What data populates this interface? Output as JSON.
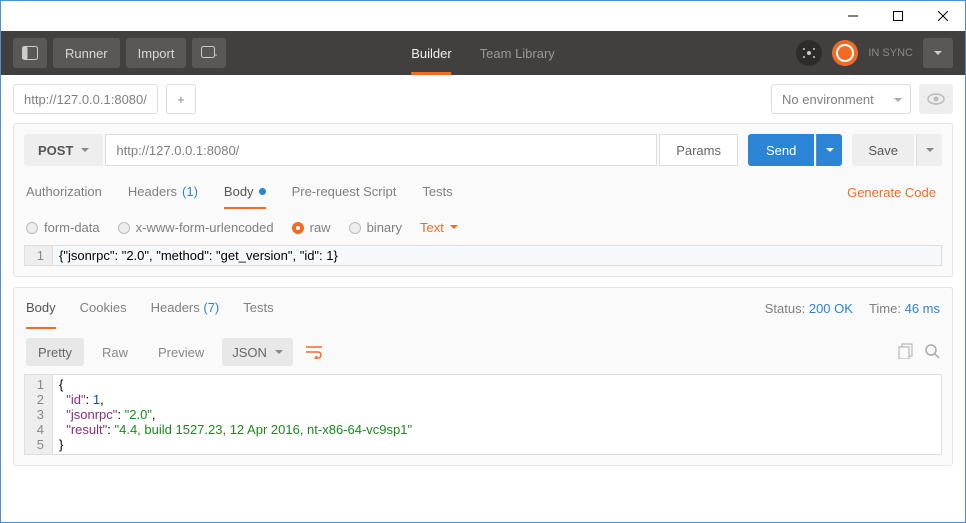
{
  "titlebar": {
    "min": "–",
    "max": "☐",
    "close": "✕"
  },
  "toolbar": {
    "runner": "Runner",
    "import": "Import",
    "tabs": {
      "builder": "Builder",
      "team": "Team Library"
    },
    "sync": "IN SYNC"
  },
  "subbar": {
    "tab_addr": "http://127.0.0.1:8080/",
    "env": "No environment"
  },
  "request": {
    "method": "POST",
    "url": "http://127.0.0.1:8080/",
    "params": "Params",
    "send": "Send",
    "save": "Save",
    "tabs": {
      "auth": "Authorization",
      "headers": "Headers",
      "headers_count": "(1)",
      "body": "Body",
      "prereq": "Pre-request Script",
      "tests": "Tests",
      "gen": "Generate Code"
    },
    "body_opts": {
      "form": "form-data",
      "xform": "x-www-form-urlencoded",
      "raw": "raw",
      "binary": "binary",
      "type": "Text"
    },
    "body_line": "1",
    "body_json": "{\"jsonrpc\": \"2.0\", \"method\": \"get_version\", \"id\": 1}"
  },
  "response": {
    "tabs": {
      "body": "Body",
      "cookies": "Cookies",
      "headers": "Headers",
      "headers_count": "(7)",
      "tests": "Tests"
    },
    "status_label": "Status:",
    "status": "200 OK",
    "time_label": "Time:",
    "time": "46 ms",
    "tools": {
      "pretty": "Pretty",
      "raw": "Raw",
      "preview": "Preview",
      "fmt": "JSON"
    },
    "json": {
      "id_key": "\"id\"",
      "id_val": "1",
      "rpc_key": "\"jsonrpc\"",
      "rpc_val": "\"2.0\"",
      "res_key": "\"result\"",
      "res_val": "\"4.4, build 1527.23, 12 Apr 2016, nt-x86-64-vc9sp1\""
    },
    "lines": [
      "1",
      "2",
      "3",
      "4",
      "5"
    ]
  },
  "chart_data": {
    "type": "table",
    "title": "JSON-RPC request/response",
    "request_body": {
      "jsonrpc": "2.0",
      "method": "get_version",
      "id": 1
    },
    "response_body": {
      "id": 1,
      "jsonrpc": "2.0",
      "result": "4.4, build 1527.23, 12 Apr 2016, nt-x86-64-vc9sp1"
    },
    "http": {
      "method": "POST",
      "url": "http://127.0.0.1:8080/",
      "status_code": 200,
      "status_text": "OK",
      "time_ms": 46,
      "request_header_count": 1,
      "response_header_count": 7
    }
  }
}
